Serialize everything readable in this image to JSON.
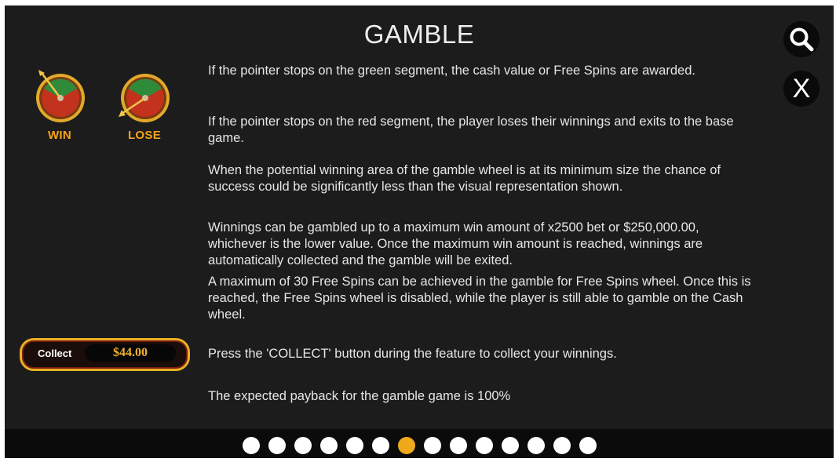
{
  "title": "GAMBLE",
  "icons": {
    "search": "magnifier-icon",
    "close": "close-icon"
  },
  "close_label": "X",
  "wheels": [
    {
      "label": "WIN",
      "icon": "gamble-wheel-win-icon"
    },
    {
      "label": "LOSE",
      "icon": "gamble-wheel-lose-icon"
    }
  ],
  "collect": {
    "label": "Collect",
    "value": "$44.00"
  },
  "paragraphs": [
    "If the pointer stops on the green segment, the cash value or Free Spins are awarded.",
    "If the pointer stops on the red segment, the player loses their winnings and exits to the base game.",
    "When the potential winning area of the gamble wheel is at its minimum size the chance of success could be significantly less than the visual representation shown.",
    "Winnings can be gambled up to a maximum win amount of x2500 bet or $250,000.00, whichever is the lower value. Once the maximum win amount is reached, winnings are automatically collected and the gamble will be exited.",
    "A maximum of 30 Free Spins can be achieved in the gamble for Free Spins wheel. Once this is reached, the Free Spins wheel is disabled, while the player is still able to gamble on the Cash wheel.",
    "Press the 'COLLECT' button during the feature to collect your winnings.",
    "The expected payback for the gamble game is 100%"
  ],
  "pagination": {
    "total": 14,
    "current": 7
  },
  "colors": {
    "active_dot": "#f0a81c",
    "wheel_green": "#2f8a3a",
    "wheel_red": "#c2321c",
    "gold": "#e8b223"
  }
}
